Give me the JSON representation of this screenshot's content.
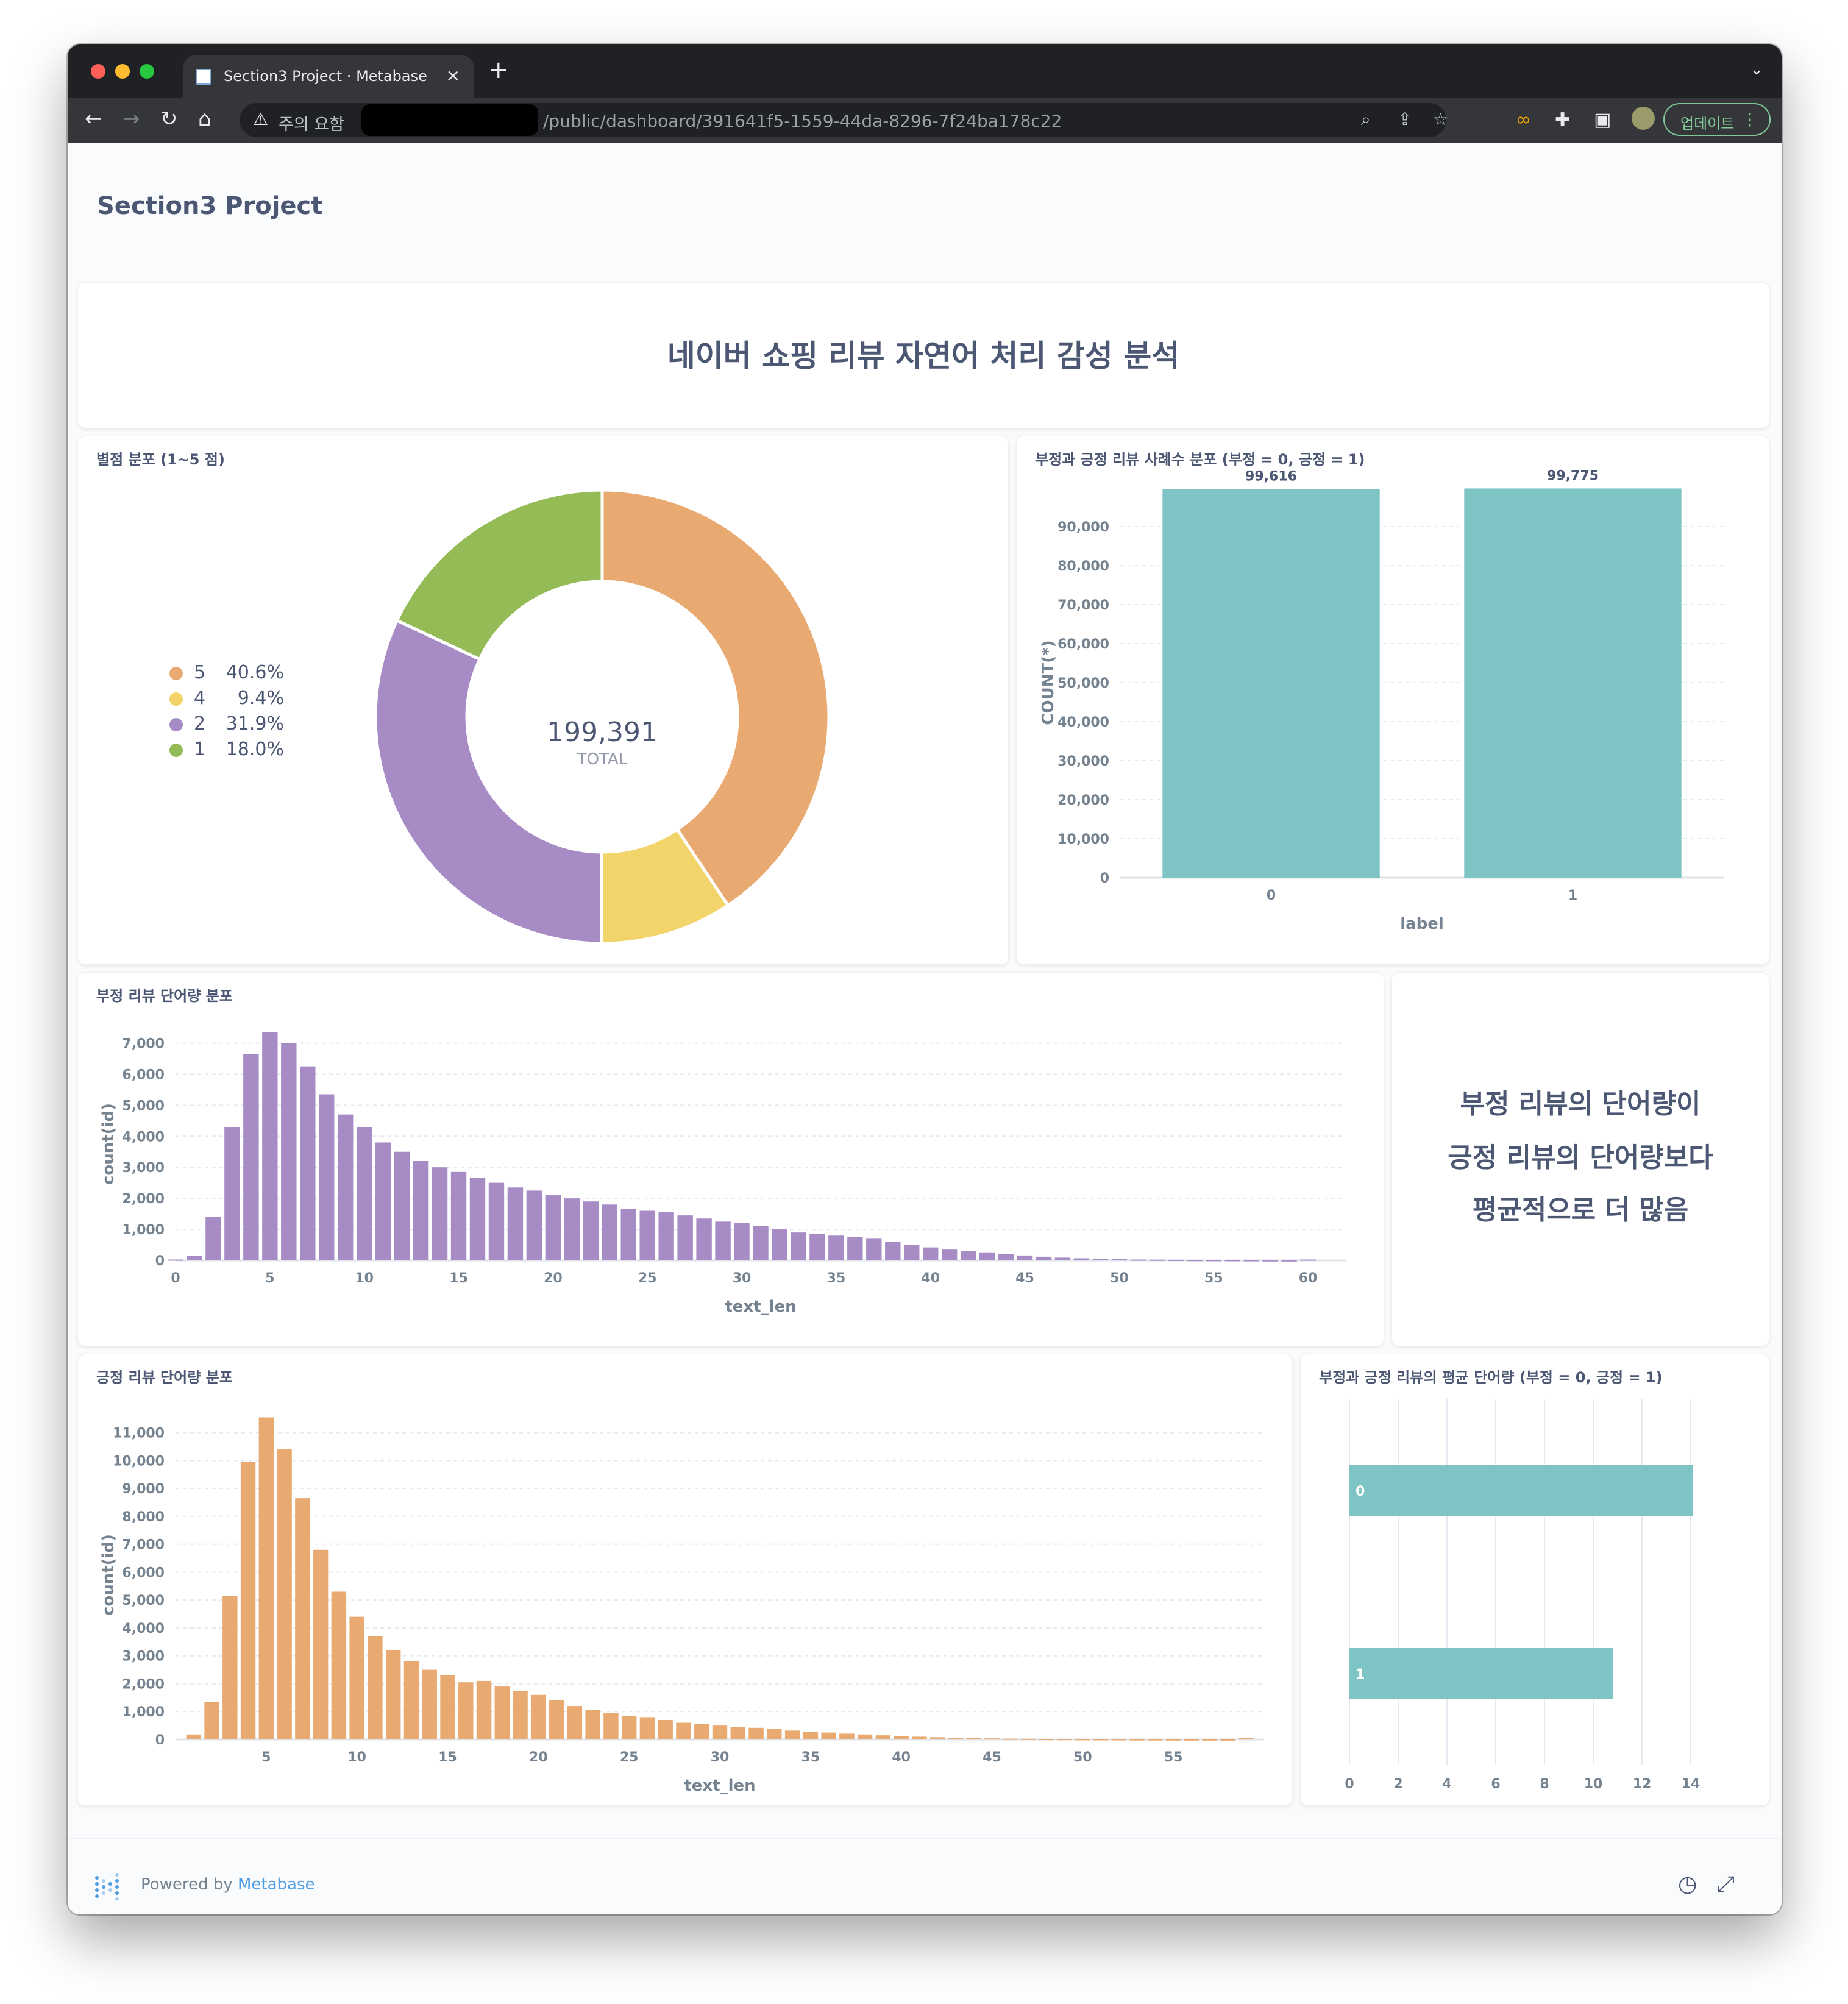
{
  "browser": {
    "tab_title": "Section3 Project · Metabase",
    "tab_close": "×",
    "new_tab": "+",
    "tab_menu": "⌄",
    "security_label": "주의 요함",
    "url": "/public/dashboard/391641f5-1559-44da-8296-7f24ba178c22",
    "update_label": "업데이트",
    "icons": [
      "back-arrow-icon",
      "forward-arrow-icon",
      "reload-icon",
      "home-icon",
      "warning-icon",
      "zoom-icon",
      "share-icon",
      "star-icon",
      "infinity-extension-icon",
      "puzzle-extension-icon",
      "sidepanel-icon",
      "profile-avatar-icon",
      "kebab-menu-icon"
    ],
    "colors": {
      "chrome_dark": "#202124",
      "chrome_toolbar": "#35363a",
      "update_green": "#81c995"
    }
  },
  "dashboard": {
    "title": "Section3 Project",
    "heading": "네이버 쇼핑 리뷰 자연어 처리 감성 분석",
    "note_lines": [
      "부정 리뷰의 단어량이",
      "긍정 리뷰의 단어량보다",
      "평균적으로 더 많음"
    ]
  },
  "cards": {
    "rating": {
      "title": "별점 분포 (1~5 점)",
      "total_value": "199,391",
      "total_label": "TOTAL",
      "legend": [
        {
          "name": "5",
          "pct": "40.6%",
          "color": "#e9aa72"
        },
        {
          "name": "4",
          "pct": "9.4%",
          "color": "#f2d46b"
        },
        {
          "name": "2",
          "pct": "31.9%",
          "color": "#a68bc5"
        },
        {
          "name": "1",
          "pct": "18.0%",
          "color": "#95bb57"
        }
      ]
    },
    "label_count": {
      "title": "부정과 긍정 리뷰 사례수 분포 (부정 = 0, 긍정 = 1)"
    },
    "neg_len": {
      "title": "부정 리뷰 단어량 분포"
    },
    "pos_len": {
      "title": "긍정 리뷰 단어량 분포"
    },
    "avg_len": {
      "title": "부정과 긍정 리뷰의 평균 단어량 (부정 = 0, 긍정 = 1)"
    }
  },
  "footer": {
    "powered_by": "Powered by",
    "brand": "Metabase",
    "icons": [
      "metabase-logo-icon",
      "clock-icon",
      "fullscreen-icon"
    ]
  },
  "chart_data": [
    {
      "type": "pie",
      "title": "별점 분포 (1~5 점)",
      "categories": [
        "5",
        "4",
        "2",
        "1"
      ],
      "values": [
        40.6,
        9.4,
        31.9,
        18.0
      ],
      "unit": "%",
      "total": 199391,
      "colors": [
        "#e9aa72",
        "#f2d46b",
        "#a68bc5",
        "#95bb57"
      ],
      "legend_position": "left"
    },
    {
      "type": "bar",
      "title": "부정과 긍정 리뷰 사례수 분포 (부정 = 0, 긍정 = 1)",
      "categories": [
        "0",
        "1"
      ],
      "values": [
        99616,
        99775
      ],
      "data_labels": [
        "99,616",
        "99,775"
      ],
      "xlabel": "label",
      "ylabel": "COUNT(*)",
      "ylim": [
        0,
        100000
      ],
      "yticks": [
        0,
        10000,
        20000,
        30000,
        40000,
        50000,
        60000,
        70000,
        80000,
        90000
      ],
      "ytick_labels": [
        "0",
        "10,000",
        "20,000",
        "30,000",
        "40,000",
        "50,000",
        "60,000",
        "70,000",
        "80,000",
        "90,000"
      ],
      "color": "#7fc4c5",
      "grid": true
    },
    {
      "type": "bar",
      "title": "부정 리뷰 단어량 분포",
      "x": [
        0,
        1,
        2,
        3,
        4,
        5,
        6,
        7,
        8,
        9,
        10,
        11,
        12,
        13,
        14,
        15,
        16,
        17,
        18,
        19,
        20,
        21,
        22,
        23,
        24,
        25,
        26,
        27,
        28,
        29,
        30,
        31,
        32,
        33,
        34,
        35,
        36,
        37,
        38,
        39,
        40,
        41,
        42,
        43,
        44,
        45,
        46,
        47,
        48,
        49,
        50,
        51,
        52,
        53,
        54,
        55,
        56,
        57,
        58,
        59,
        60
      ],
      "values": [
        30,
        150,
        1400,
        4300,
        6650,
        7350,
        7000,
        6250,
        5350,
        4700,
        4300,
        3800,
        3500,
        3200,
        3000,
        2850,
        2650,
        2500,
        2350,
        2250,
        2100,
        2000,
        1900,
        1800,
        1650,
        1600,
        1550,
        1450,
        1350,
        1250,
        1200,
        1100,
        1000,
        900,
        850,
        800,
        750,
        700,
        600,
        500,
        420,
        350,
        300,
        240,
        200,
        160,
        120,
        90,
        70,
        50,
        40,
        30,
        25,
        20,
        15,
        12,
        10,
        8,
        5,
        3,
        30
      ],
      "xlabel": "text_len",
      "ylabel": "count(id)",
      "xticks": [
        0,
        5,
        10,
        15,
        20,
        25,
        30,
        35,
        40,
        45,
        50,
        55,
        60
      ],
      "xlim": [
        0,
        62
      ],
      "ylim": [
        0,
        7500
      ],
      "yticks": [
        0,
        1000,
        2000,
        3000,
        4000,
        5000,
        6000,
        7000
      ],
      "ytick_labels": [
        "0",
        "1,000",
        "2,000",
        "3,000",
        "4,000",
        "5,000",
        "6,000",
        "7,000"
      ],
      "color": "#a68bc5",
      "grid": true
    },
    {
      "type": "bar",
      "title": "긍정 리뷰 단어량 분포",
      "x": [
        1,
        2,
        3,
        4,
        5,
        6,
        7,
        8,
        9,
        10,
        11,
        12,
        13,
        14,
        15,
        16,
        17,
        18,
        19,
        20,
        21,
        22,
        23,
        24,
        25,
        26,
        27,
        28,
        29,
        30,
        31,
        32,
        33,
        34,
        35,
        36,
        37,
        38,
        39,
        40,
        41,
        42,
        43,
        44,
        45,
        46,
        47,
        48,
        49,
        50,
        51,
        52,
        53,
        54,
        55,
        56,
        57,
        58,
        59
      ],
      "values": [
        180,
        1350,
        5150,
        9950,
        11550,
        10400,
        8650,
        6800,
        5300,
        4400,
        3700,
        3200,
        2800,
        2500,
        2300,
        2050,
        2100,
        1900,
        1750,
        1600,
        1400,
        1200,
        1050,
        950,
        850,
        800,
        700,
        600,
        550,
        500,
        450,
        420,
        380,
        320,
        280,
        250,
        210,
        180,
        150,
        120,
        100,
        80,
        60,
        50,
        40,
        30,
        25,
        20,
        18,
        15,
        12,
        10,
        8,
        6,
        5,
        4,
        3,
        2,
        60
      ],
      "xlabel": "text_len",
      "ylabel": "count(id)",
      "xticks": [
        5,
        10,
        15,
        20,
        25,
        30,
        35,
        40,
        45,
        50,
        55
      ],
      "xlim": [
        0,
        60
      ],
      "ylim": [
        0,
        11800
      ],
      "yticks": [
        0,
        1000,
        2000,
        3000,
        4000,
        5000,
        6000,
        7000,
        8000,
        9000,
        10000,
        11000
      ],
      "ytick_labels": [
        "0",
        "1,000",
        "2,000",
        "3,000",
        "4,000",
        "5,000",
        "6,000",
        "7,000",
        "8,000",
        "9,000",
        "10,000",
        "11,000"
      ],
      "color": "#e9aa72",
      "grid": true
    },
    {
      "type": "bar",
      "orientation": "horizontal",
      "title": "부정과 긍정 리뷰의 평균 단어량 (부정 = 0, 긍정 = 1)",
      "categories": [
        "0",
        "1"
      ],
      "values": [
        14.1,
        10.8
      ],
      "xlim": [
        0,
        14
      ],
      "xticks": [
        0,
        2,
        4,
        6,
        8,
        10,
        12,
        14
      ],
      "color": "#7fc4c5",
      "grid": true
    }
  ]
}
